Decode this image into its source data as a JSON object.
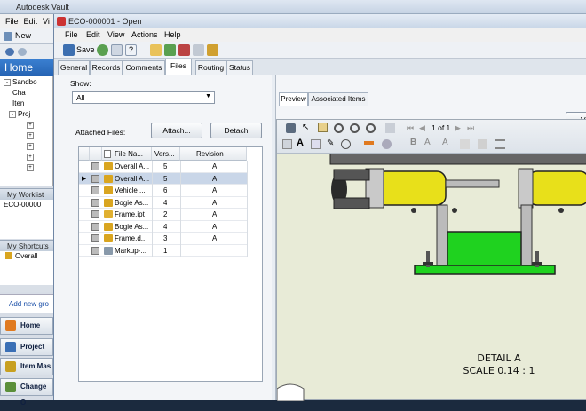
{
  "bg": {
    "title": "Autodesk Vault",
    "menu": [
      "File",
      "Edit",
      "Vi"
    ],
    "toolbar_new": "New",
    "home_tab": "Home",
    "tree": [
      "Sandbo",
      "Cha",
      "Iten",
      "Proj"
    ],
    "worklist_header": "My Worklist",
    "worklist_item": "ECO-00000",
    "shortcuts_header": "My Shortcuts",
    "shortcut_item": "Overall",
    "add_new_group": "Add new gro",
    "nav_buttons": [
      "Home",
      "Project Ex",
      "Item Mas",
      "Change O"
    ]
  },
  "dialog": {
    "title": "ECO-000001 - Open",
    "menu": [
      "File",
      "Edit",
      "View",
      "Actions",
      "Help"
    ],
    "save_label": "Save",
    "tabs": [
      "General",
      "Records",
      "Comments",
      "Files",
      "Routing",
      "Status"
    ],
    "active_tab": "Files"
  },
  "files": {
    "show_label": "Show:",
    "show_value": "All",
    "attached_label": "Attached Files:",
    "attach_button": "Attach...",
    "detach_button": "Detach",
    "columns": [
      "File Na...",
      "Vers...",
      "Revision"
    ],
    "rows": [
      {
        "name": "Overall A...",
        "version": "5",
        "revision": "A",
        "color": "#d9a520"
      },
      {
        "name": "Overall A...",
        "version": "5",
        "revision": "A",
        "color": "#d9a520"
      },
      {
        "name": "Vehicle ...",
        "version": "6",
        "revision": "A",
        "color": "#d9a520"
      },
      {
        "name": "Bogie As...",
        "version": "4",
        "revision": "A",
        "color": "#d9a520"
      },
      {
        "name": "Frame.ipt",
        "version": "2",
        "revision": "A",
        "color": "#e0b030"
      },
      {
        "name": "Bogie As...",
        "version": "4",
        "revision": "A",
        "color": "#d9a520"
      },
      {
        "name": "Frame.d...",
        "version": "3",
        "revision": "A",
        "color": "#d9a520"
      },
      {
        "name": "Markup-...",
        "version": "1",
        "revision": "",
        "color": "#8899aa"
      }
    ],
    "selected_row": 1
  },
  "preview": {
    "tabs": [
      "Preview",
      "Associated Items"
    ],
    "page_indicator": "1 of 1",
    "view_button": "Vi",
    "detail_title": "DETAIL  A",
    "detail_scale": "SCALE 0.14 : 1",
    "colors": {
      "frame_green": "#1fd21f",
      "wheel_yellow": "#e8e01a",
      "paper": "#e8ebd7"
    }
  }
}
